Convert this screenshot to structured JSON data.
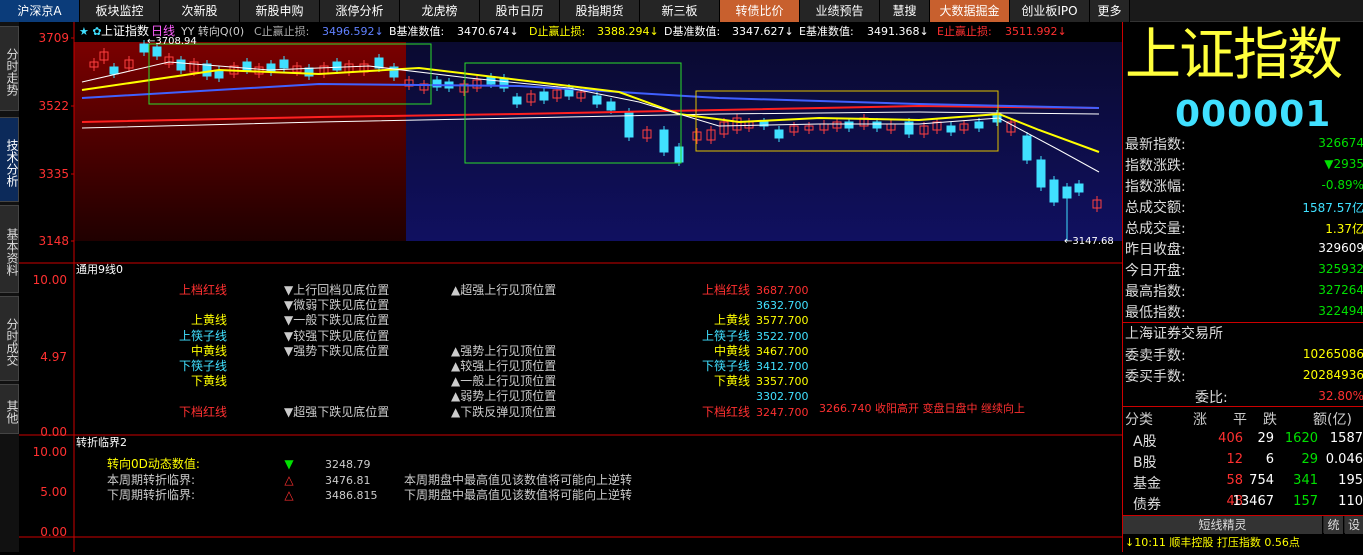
{
  "nav": [
    "沪深京A",
    "板块监控",
    "次新股",
    "新股申购",
    "涨停分析",
    "龙虎榜",
    "股市日历",
    "股指期货",
    "新三板",
    "转债比价",
    "业绩预告",
    "慧搜",
    "大数据掘金",
    "创业板IPO",
    "更多"
  ],
  "nav_widths": [
    80,
    80,
    80,
    80,
    80,
    80,
    80,
    80,
    80,
    80,
    80,
    50,
    80,
    80,
    40
  ],
  "left_tabs": [
    "分时走势",
    "技术分析",
    "基本资料",
    "分时成交",
    "其他"
  ],
  "chart_header": {
    "title": "上证指数",
    "period": "日线",
    "indicator": "YY 转向Q(0)",
    "c_label": "C止赢止损:",
    "c_val": "3496.592↓",
    "b_label": "B基准数值:",
    "b_val": "3470.674↓",
    "d_label": "D止赢止损:",
    "d_val": "3388.294↓",
    "d2_label": "D基准数值:",
    "d2_val": "3347.627↓",
    "e_label": "E基准数值:",
    "e_val": "3491.368↓",
    "e2_label": "E止赢止损:",
    "e2_val": "3511.992↓"
  },
  "price_axis": [
    "3709",
    "3522",
    "3335",
    "3148"
  ],
  "high_label": "3708.94",
  "low_label": "3147.68",
  "panel2": {
    "title": "通用9线0",
    "axis": [
      "10.00",
      "4.97",
      "0.00"
    ],
    "left_labels": [
      {
        "t": "上档红线",
        "c": "#ff3030"
      },
      {
        "t": "上黄线",
        "c": "#ffff00"
      },
      {
        "t": "上筷子线",
        "c": "#40e0ff"
      },
      {
        "t": "中黄线",
        "c": "#ffff00"
      },
      {
        "t": "下筷子线",
        "c": "#40e0ff"
      },
      {
        "t": "下黄线",
        "c": "#ffff00"
      },
      {
        "t": "下档红线",
        "c": "#ff3030"
      }
    ],
    "mid_labels": [
      "▼上行回档见底位置",
      "▼微弱下跌见底位置",
      "▼一般下跌见底位置",
      "▼较强下跌见底位置",
      "▼强势下跌见底位置",
      "▼超强下跌见底位置"
    ],
    "mid2_labels": [
      "▲超强上行见顶位置",
      "▲强势上行见顶位置",
      "▲较强上行见顶位置",
      "▲一般上行见顶位置",
      "▲弱势上行见顶位置",
      "▲下跌反弹见顶位置"
    ],
    "right_labels": [
      {
        "t": "上档红线",
        "v": "3687.700"
      },
      {
        "t": "",
        "v": "3632.700"
      },
      {
        "t": "上黄线",
        "v": "3577.700"
      },
      {
        "t": "上筷子线",
        "v": "3522.700"
      },
      {
        "t": "中黄线",
        "v": "3467.700"
      },
      {
        "t": "下筷子线",
        "v": "3412.700"
      },
      {
        "t": "下黄线",
        "v": "3357.700"
      },
      {
        "t": "",
        "v": "3302.700"
      },
      {
        "t": "下档红线",
        "v": "3247.700"
      }
    ],
    "note": "3266.740 收阳高开 变盘日盘中 继续向上"
  },
  "panel3": {
    "title": "转折临界2",
    "axis": [
      "10.00",
      "5.00",
      "0.00"
    ],
    "rows": [
      {
        "k": "转向0D动态数值:",
        "sym": "▼",
        "v": "3248.79",
        "desc": ""
      },
      {
        "k": "本周期转折临界:",
        "sym": "△",
        "v": "3476.81",
        "desc": "本周期盘中最高值见该数值将可能向上逆转"
      },
      {
        "k": "下周期转折临界:",
        "sym": "△",
        "v": "3486.815",
        "desc": "下周期盘中最高值见该数值将可能向上逆转"
      }
    ]
  },
  "quote": {
    "name": "上证指数",
    "code": "000001",
    "rows": [
      {
        "k": "最新指数:",
        "v": "326674",
        "c": "green"
      },
      {
        "k": "指数涨跌:",
        "v": "▼2935",
        "c": "green"
      },
      {
        "k": "指数涨幅:",
        "v": "-0.89%",
        "c": "green"
      },
      {
        "k": "总成交额:",
        "v": "1587.57亿",
        "c": "cyan"
      },
      {
        "k": "总成交量:",
        "v": "1.37亿",
        "c": "yellow"
      },
      {
        "k": "昨日收盘:",
        "v": "329609",
        "c": "white"
      },
      {
        "k": "今日开盘:",
        "v": "325932",
        "c": "green"
      },
      {
        "k": "最高指数:",
        "v": "327264",
        "c": "green"
      },
      {
        "k": "最低指数:",
        "v": "322494",
        "c": "green"
      }
    ],
    "exchange": "上海证券交易所",
    "rows2": [
      {
        "k": "委卖手数:",
        "v": "10265086",
        "c": "yellow"
      },
      {
        "k": "委买手数:",
        "v": "20284936",
        "c": "yellow"
      },
      {
        "k": "委比:",
        "v": "32.80%",
        "c": "red"
      }
    ],
    "table_header": [
      "分类",
      "涨",
      "平",
      "跌",
      "额(亿)"
    ],
    "table": [
      [
        "A股",
        "406",
        "29",
        "1620",
        "1587"
      ],
      [
        "B股",
        "12",
        "6",
        "29",
        "0.046"
      ],
      [
        "基金",
        "58",
        "754",
        "341",
        "195"
      ],
      [
        "债券",
        "48",
        "13467",
        "157",
        "110"
      ]
    ],
    "footer_tabs": [
      "短线精灵",
      "统",
      "设"
    ],
    "ticker": "↓10:11 顺丰控股 打压指数 0.56点"
  }
}
